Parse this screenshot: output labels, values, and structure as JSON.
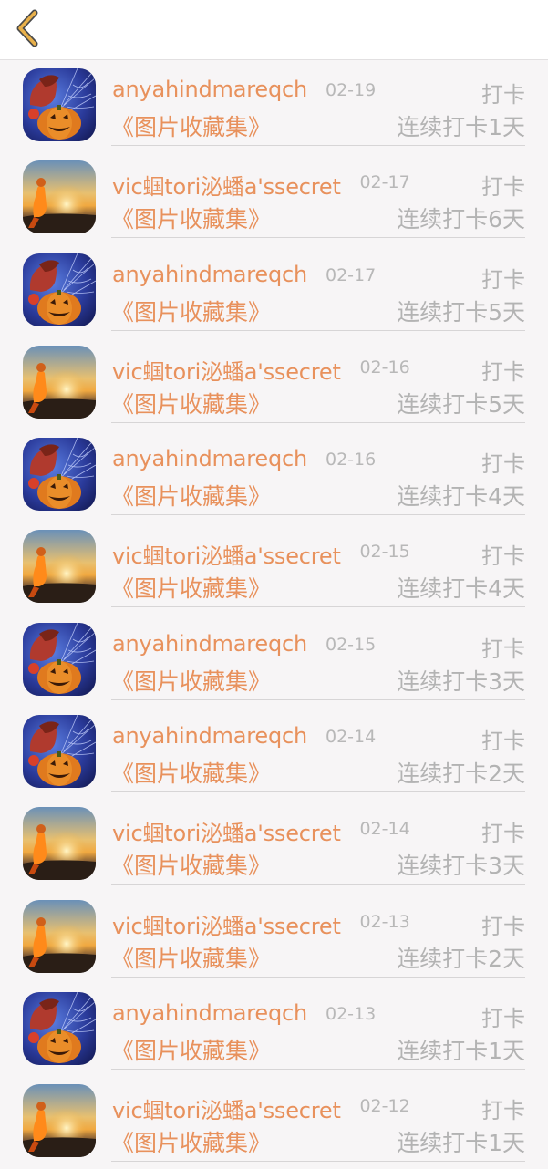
{
  "header": {
    "back_icon": "chevron-left-icon",
    "back_color": "#e8b04a"
  },
  "colors": {
    "accent": "#e8915c",
    "muted": "#b3b3b3"
  },
  "entries": [
    {
      "user": "anyahindmareqch",
      "avatar": "pumpkin-avatar",
      "date": "02-19",
      "action": "打卡",
      "book": "《图片收藏集》",
      "streak": "连续打卡1天"
    },
    {
      "user": "vic蝈tori泌蟠a'ssecret",
      "avatar": "sunset-avatar",
      "date": "02-17",
      "action": "打卡",
      "book": "《图片收藏集》",
      "streak": "连续打卡6天"
    },
    {
      "user": "anyahindmareqch",
      "avatar": "pumpkin-avatar",
      "date": "02-17",
      "action": "打卡",
      "book": "《图片收藏集》",
      "streak": "连续打卡5天"
    },
    {
      "user": "vic蝈tori泌蟠a'ssecret",
      "avatar": "sunset-avatar",
      "date": "02-16",
      "action": "打卡",
      "book": "《图片收藏集》",
      "streak": "连续打卡5天"
    },
    {
      "user": "anyahindmareqch",
      "avatar": "pumpkin-avatar",
      "date": "02-16",
      "action": "打卡",
      "book": "《图片收藏集》",
      "streak": "连续打卡4天"
    },
    {
      "user": "vic蝈tori泌蟠a'ssecret",
      "avatar": "sunset-avatar",
      "date": "02-15",
      "action": "打卡",
      "book": "《图片收藏集》",
      "streak": "连续打卡4天"
    },
    {
      "user": "anyahindmareqch",
      "avatar": "pumpkin-avatar",
      "date": "02-15",
      "action": "打卡",
      "book": "《图片收藏集》",
      "streak": "连续打卡3天"
    },
    {
      "user": "anyahindmareqch",
      "avatar": "pumpkin-avatar",
      "date": "02-14",
      "action": "打卡",
      "book": "《图片收藏集》",
      "streak": "连续打卡2天"
    },
    {
      "user": "vic蝈tori泌蟠a'ssecret",
      "avatar": "sunset-avatar",
      "date": "02-14",
      "action": "打卡",
      "book": "《图片收藏集》",
      "streak": "连续打卡3天"
    },
    {
      "user": "vic蝈tori泌蟠a'ssecret",
      "avatar": "sunset-avatar",
      "date": "02-13",
      "action": "打卡",
      "book": "《图片收藏集》",
      "streak": "连续打卡2天"
    },
    {
      "user": "anyahindmareqch",
      "avatar": "pumpkin-avatar",
      "date": "02-13",
      "action": "打卡",
      "book": "《图片收藏集》",
      "streak": "连续打卡1天"
    },
    {
      "user": "vic蝈tori泌蟠a'ssecret",
      "avatar": "sunset-avatar",
      "date": "02-12",
      "action": "打卡",
      "book": "《图片收藏集》",
      "streak": "连续打卡1天"
    }
  ]
}
